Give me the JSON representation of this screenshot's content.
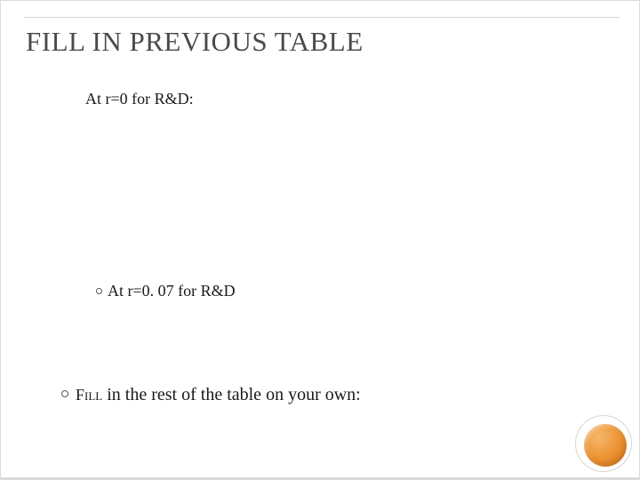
{
  "slide": {
    "title": "FILL IN PREVIOUS TABLE",
    "line1": "At r=0 for R&D:",
    "sub_bullet": "At r=0. 07 for R&D",
    "line3_prefix": "Fill",
    "line3_rest": " in the rest of the table on your own:"
  }
}
